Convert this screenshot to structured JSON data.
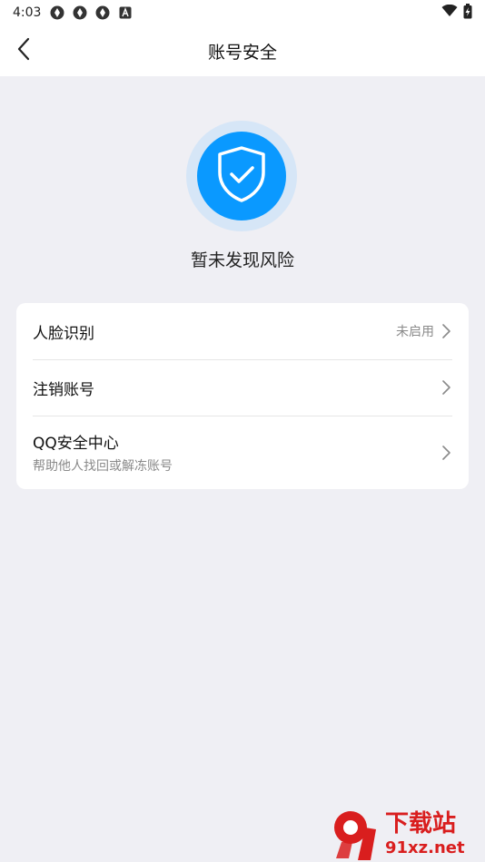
{
  "status_bar": {
    "time": "4:03",
    "left_icons": [
      "notification-app-icon",
      "notification-app-icon",
      "notification-app-icon",
      "notification-a-icon"
    ],
    "right_icons": [
      "wifi-icon",
      "battery-charging-icon"
    ]
  },
  "nav": {
    "back_icon": "chevron-left-icon",
    "title": "账号安全"
  },
  "status_panel": {
    "icon": "shield-check-icon",
    "text": "暂未发现风险"
  },
  "settings": {
    "items": [
      {
        "label": "人脸识别",
        "value": "未启用",
        "sub": ""
      },
      {
        "label": "注销账号",
        "value": "",
        "sub": ""
      },
      {
        "label": "QQ安全中心",
        "value": "",
        "sub": "帮助他人找回或解冻账号"
      }
    ]
  },
  "watermark": {
    "main": "下载站",
    "sub": "91xz.net",
    "logo_text": "91"
  },
  "colors": {
    "accent": "#0a99ff",
    "page_bg": "#efeff4",
    "watermark_red": "#d91e1e"
  }
}
